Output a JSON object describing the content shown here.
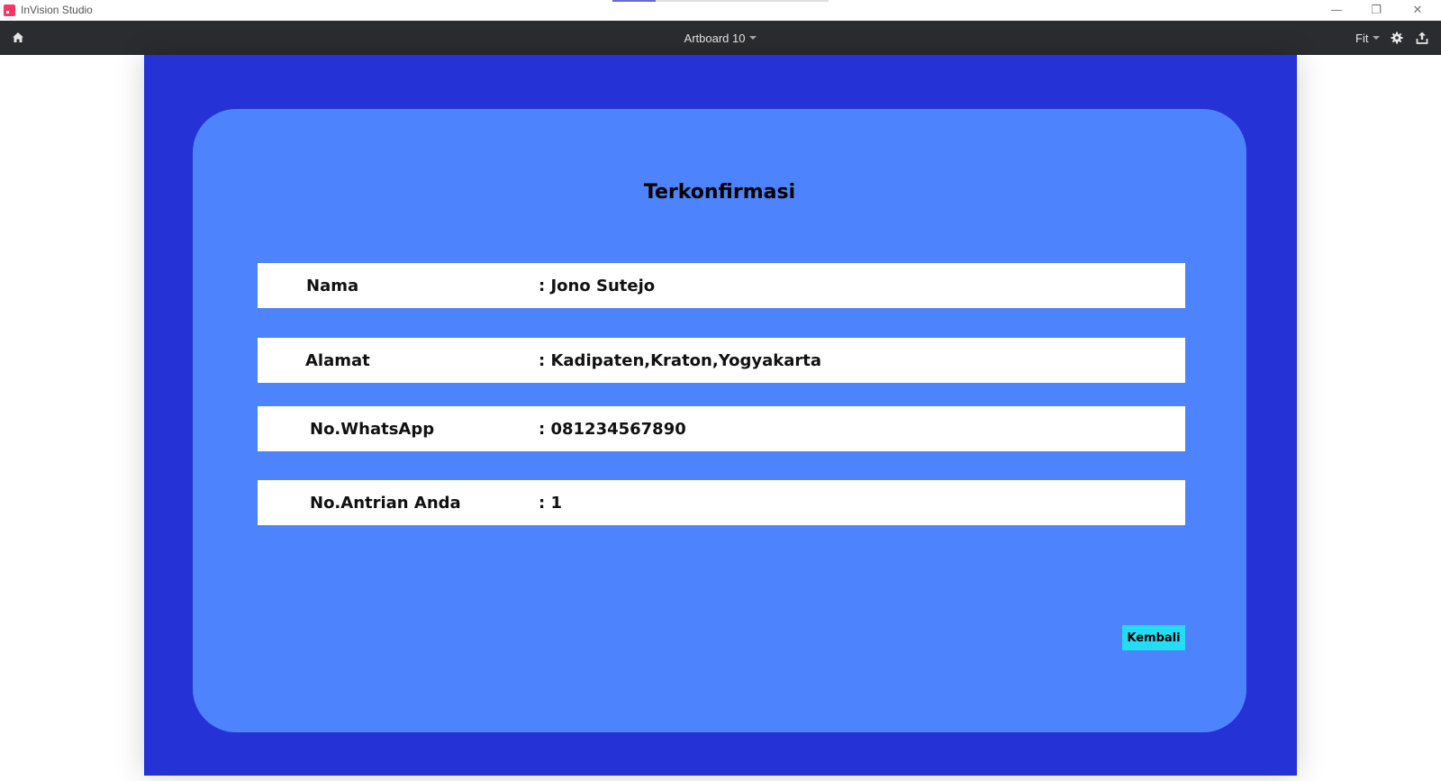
{
  "window": {
    "app_title": "InVision Studio",
    "minimize_glyph": "—",
    "maximize_glyph": "❐",
    "close_glyph": "✕"
  },
  "toolbar": {
    "document_title": "Artboard 10",
    "zoom_label": "Fit"
  },
  "icons": {
    "home": "home-icon",
    "settings": "gear-icon",
    "share": "share-icon",
    "app_logo": "invision-logo"
  },
  "colors": {
    "artboard_bg": "#2432d6",
    "card_bg": "#4d83fc",
    "button_bg": "#23ddf5",
    "toolbar_bg": "#2b2c2f",
    "logo": "#ff3366"
  },
  "confirmation": {
    "title": "Terkonfirmasi",
    "rows": [
      {
        "label": "Nama",
        "value": ": Jono Sutejo"
      },
      {
        "label": "Alamat",
        "value": ": Kadipaten,Kraton,Yogyakarta"
      },
      {
        "label": "No.WhatsApp",
        "value": ": 081234567890"
      },
      {
        "label": "No.Antrian Anda",
        "value": ": 1"
      }
    ],
    "back_button": "Kembali"
  }
}
